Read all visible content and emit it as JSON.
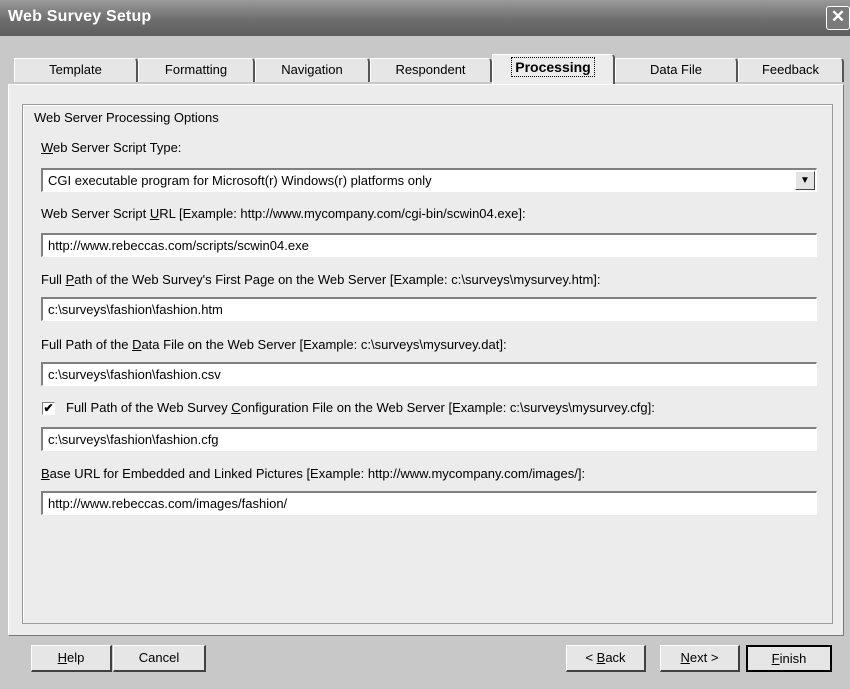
{
  "window": {
    "title": "Web Survey Setup",
    "close_glyph": "✕"
  },
  "tabs": [
    {
      "label": "Template"
    },
    {
      "label": "Formatting"
    },
    {
      "label": "Navigation"
    },
    {
      "label": "Respondent"
    },
    {
      "label": "Processing",
      "active": true
    },
    {
      "label": "Data File"
    },
    {
      "label": "Feedback"
    }
  ],
  "group": {
    "title": "Web Server Processing Options",
    "script_type": {
      "label_ul": "W",
      "label_rest": "eb Server Script Type:",
      "value": "CGI executable program for Microsoft(r) Windows(r) platforms only",
      "arrow_icon": "chevron-down-icon"
    },
    "script_url": {
      "label_pre": "Web Server Script ",
      "label_ul": "U",
      "label_post": "RL [Example: http://www.mycompany.com/cgi-bin/scwin04.exe]:",
      "value": "http://www.rebeccas.com/scripts/scwin04.exe"
    },
    "first_page": {
      "label_pre": "Full ",
      "label_ul": "P",
      "label_post": "ath of the Web Survey's First Page on the Web Server [Example: c:\\surveys\\mysurvey.htm]:",
      "value": "c:\\surveys\\fashion\\fashion.htm"
    },
    "data_file": {
      "label_pre": "Full Path of the ",
      "label_ul": "D",
      "label_post": "ata File on the Web Server [Example: c:\\surveys\\mysurvey.dat]:",
      "value": "c:\\surveys\\fashion\\fashion.csv"
    },
    "config_file": {
      "checked": true,
      "check_glyph": "✔",
      "label_pre": "Full Path of the Web Survey ",
      "label_ul": "C",
      "label_post": "onfiguration File on the Web Server [Example: c:\\surveys\\mysurvey.cfg]:",
      "value": "c:\\surveys\\fashion\\fashion.cfg"
    },
    "base_url": {
      "label_ul": "B",
      "label_post": "ase URL for Embedded and Linked Pictures [Example: http://www.mycompany.com/images/]:",
      "value": "http://www.rebeccas.com/images/fashion/"
    }
  },
  "buttons": {
    "help_ul": "H",
    "help_rest": "elp",
    "cancel": "Cancel",
    "back_pre": "< ",
    "back_ul": "B",
    "back_rest": "ack",
    "next_ul": "N",
    "next_rest": "ext >",
    "finish_ul": "F",
    "finish_rest": "inish"
  }
}
